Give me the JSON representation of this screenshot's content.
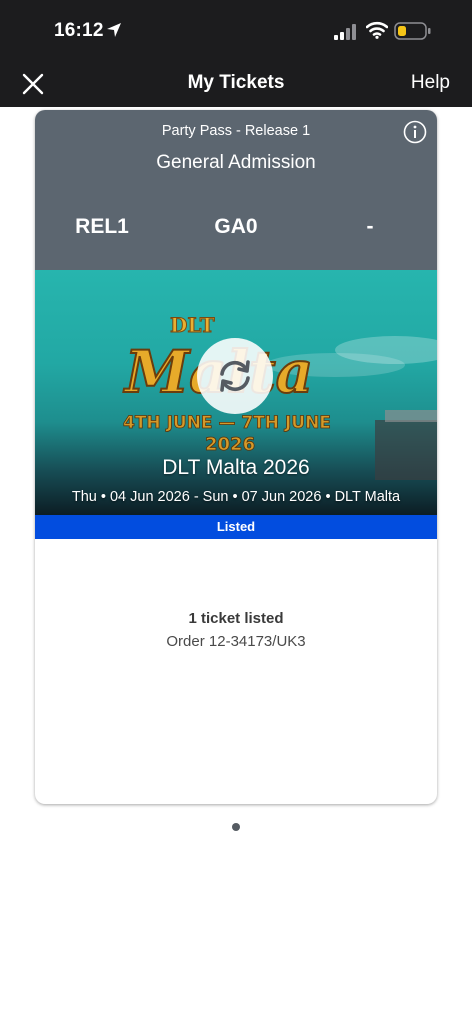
{
  "status_bar": {
    "time": "16:12",
    "icons": [
      "location-arrow-icon",
      "cellular-signal-icon",
      "wifi-icon",
      "battery-icon"
    ],
    "battery_color": "#f5c518"
  },
  "nav": {
    "title": "My Tickets",
    "help_label": "Help",
    "close_icon": "close-icon"
  },
  "ticket": {
    "type": "Party Pass - Release 1",
    "admission": "General Admission",
    "section": "REL1",
    "row": "GA0",
    "seat": "-",
    "info_icon": "info-icon",
    "event": {
      "name": "DLT Malta 2026",
      "dates": "Thu • 04 Jun 2026 - Sun • 07 Jun 2026 • DLT Malta",
      "refresh_icon": "refresh-icon"
    },
    "status_label": "Listed",
    "status_color": "#024ddf",
    "count_text": "1 ticket listed",
    "order_text": "Order 12-34173/UK3"
  },
  "colors": {
    "header_bg": "#1c1c1e",
    "card_header_bg": "#5c6670",
    "banner_teal": "#22a8a4"
  }
}
